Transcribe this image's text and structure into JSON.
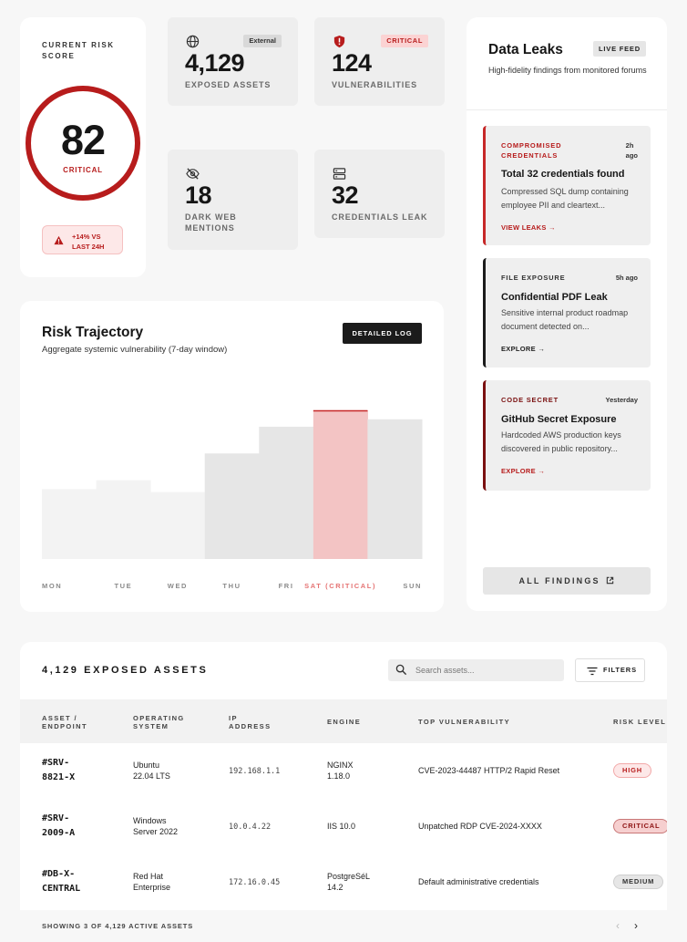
{
  "risk_score": {
    "title": "CURRENT RISK SCORE",
    "value": "82",
    "status": "CRITICAL",
    "trend": "+14% VS LAST 24H",
    "trend_line1": "+14% VS",
    "trend_line2": "LAST 24H"
  },
  "metrics": [
    {
      "icon": "globe-icon",
      "value": "4,129",
      "label": "EXPOSED ASSETS",
      "badge": "External"
    },
    {
      "icon": "shield-icon",
      "value": "124",
      "label": "VULNERABILITIES",
      "badge": "CRITICAL"
    },
    {
      "icon": "eye-off-icon",
      "value": "18",
      "label": "DARK WEB MENTIONS",
      "label_line1": "DARK WEB",
      "label_line2": "MENTIONS"
    },
    {
      "icon": "server-icon",
      "value": "32",
      "label": "CREDENTIALS LEAK"
    }
  ],
  "data_leaks": {
    "title": "Data Leaks",
    "badge": "LIVE FEED",
    "subtitle": "High-fidelity findings from monitored forums",
    "items": [
      {
        "category": "COMPROMISED CREDENTIALS",
        "time": "2h ago",
        "time_line1": "2h",
        "time_line2": "ago",
        "title": "Total 32 credentials found",
        "description": "Compressed SQL dump containing employee PII and cleartext...",
        "link": "VIEW LEAKS →",
        "accent": "#c62828"
      },
      {
        "category": "FILE EXPOSURE",
        "time": "5h ago",
        "title": "Confidential PDF Leak",
        "description": "Sensitive internal product roadmap document detected on...",
        "link": "EXPLORE →",
        "accent": "#1b1b1b"
      },
      {
        "category": "CODE SECRET",
        "time": "Yesterday",
        "title": "GitHub Secret Exposure",
        "description": "Hardcoded AWS production keys discovered in public repository...",
        "link": "EXPLORE →",
        "accent": "#7a1010"
      }
    ],
    "all_findings": "ALL FINDINGS"
  },
  "trajectory": {
    "title": "Risk Trajectory",
    "subtitle": "Aggregate systemic vulnerability (7-day window)",
    "button": "DETAILED LOG"
  },
  "chart_data": {
    "type": "bar",
    "title": "Risk Trajectory",
    "categories": [
      "MON",
      "TUE",
      "WED",
      "THU",
      "FRI",
      "SAT (CRITICAL)",
      "SUN"
    ],
    "values": [
      47,
      53,
      45,
      71,
      89,
      100,
      94
    ],
    "ylim": [
      0,
      100
    ],
    "highlight_index": 5,
    "grid": false,
    "colors": {
      "bar_low": "#f3f3f3",
      "bar_mid": "#e6e6e6",
      "bar_critical": "#f3c4c4",
      "critical_line": "#c62828",
      "critical_label": "#e57373"
    }
  },
  "assets": {
    "title": "4,129 EXPOSED ASSETS",
    "search_placeholder": "Search assets...",
    "filters_label": "FILTERS",
    "columns": [
      "ASSET / ENDPOINT",
      "OPERATING SYSTEM",
      "IP ADDRESS",
      "ENGINE",
      "TOP VULNERABILITY",
      "RISK LEVEL"
    ],
    "column_lines": [
      [
        "ASSET /",
        "ENDPOINT"
      ],
      [
        "OPERATING",
        "SYSTEM"
      ],
      [
        "IP",
        "ADDRESS"
      ],
      [
        "ENGINE"
      ],
      [
        "TOP VULNERABILITY"
      ],
      [
        "RISK LEVEL"
      ]
    ],
    "rows": [
      {
        "asset": [
          "#SRV-",
          "8821-X"
        ],
        "os": [
          "Ubuntu",
          "22.04 LTS"
        ],
        "ip": "192.168.1.1",
        "engine": [
          "NGINX",
          "1.18.0"
        ],
        "vulnerability": "CVE-2023-44487 HTTP/2 Rapid Reset",
        "risk": "HIGH"
      },
      {
        "asset": [
          "#SRV-",
          "2009-A"
        ],
        "os": [
          "Windows",
          "Server 2022"
        ],
        "ip": "10.0.4.22",
        "engine": [
          "IIS 10.0"
        ],
        "vulnerability": "Unpatched RDP CVE-2024-XXXX",
        "risk": "CRITICAL"
      },
      {
        "asset": [
          "#DB-X-",
          "CENTRAL"
        ],
        "os": [
          "Red Hat",
          "Enterprise"
        ],
        "ip": "172.16.0.45",
        "engine": [
          "PostgreSéL",
          "14.2"
        ],
        "vulnerability": "Default administrative credentials",
        "risk": "MEDIUM"
      }
    ],
    "footer": "SHOWING 3 OF 4,129 ACTIVE ASSETS",
    "prev": "‹",
    "next": "›"
  }
}
